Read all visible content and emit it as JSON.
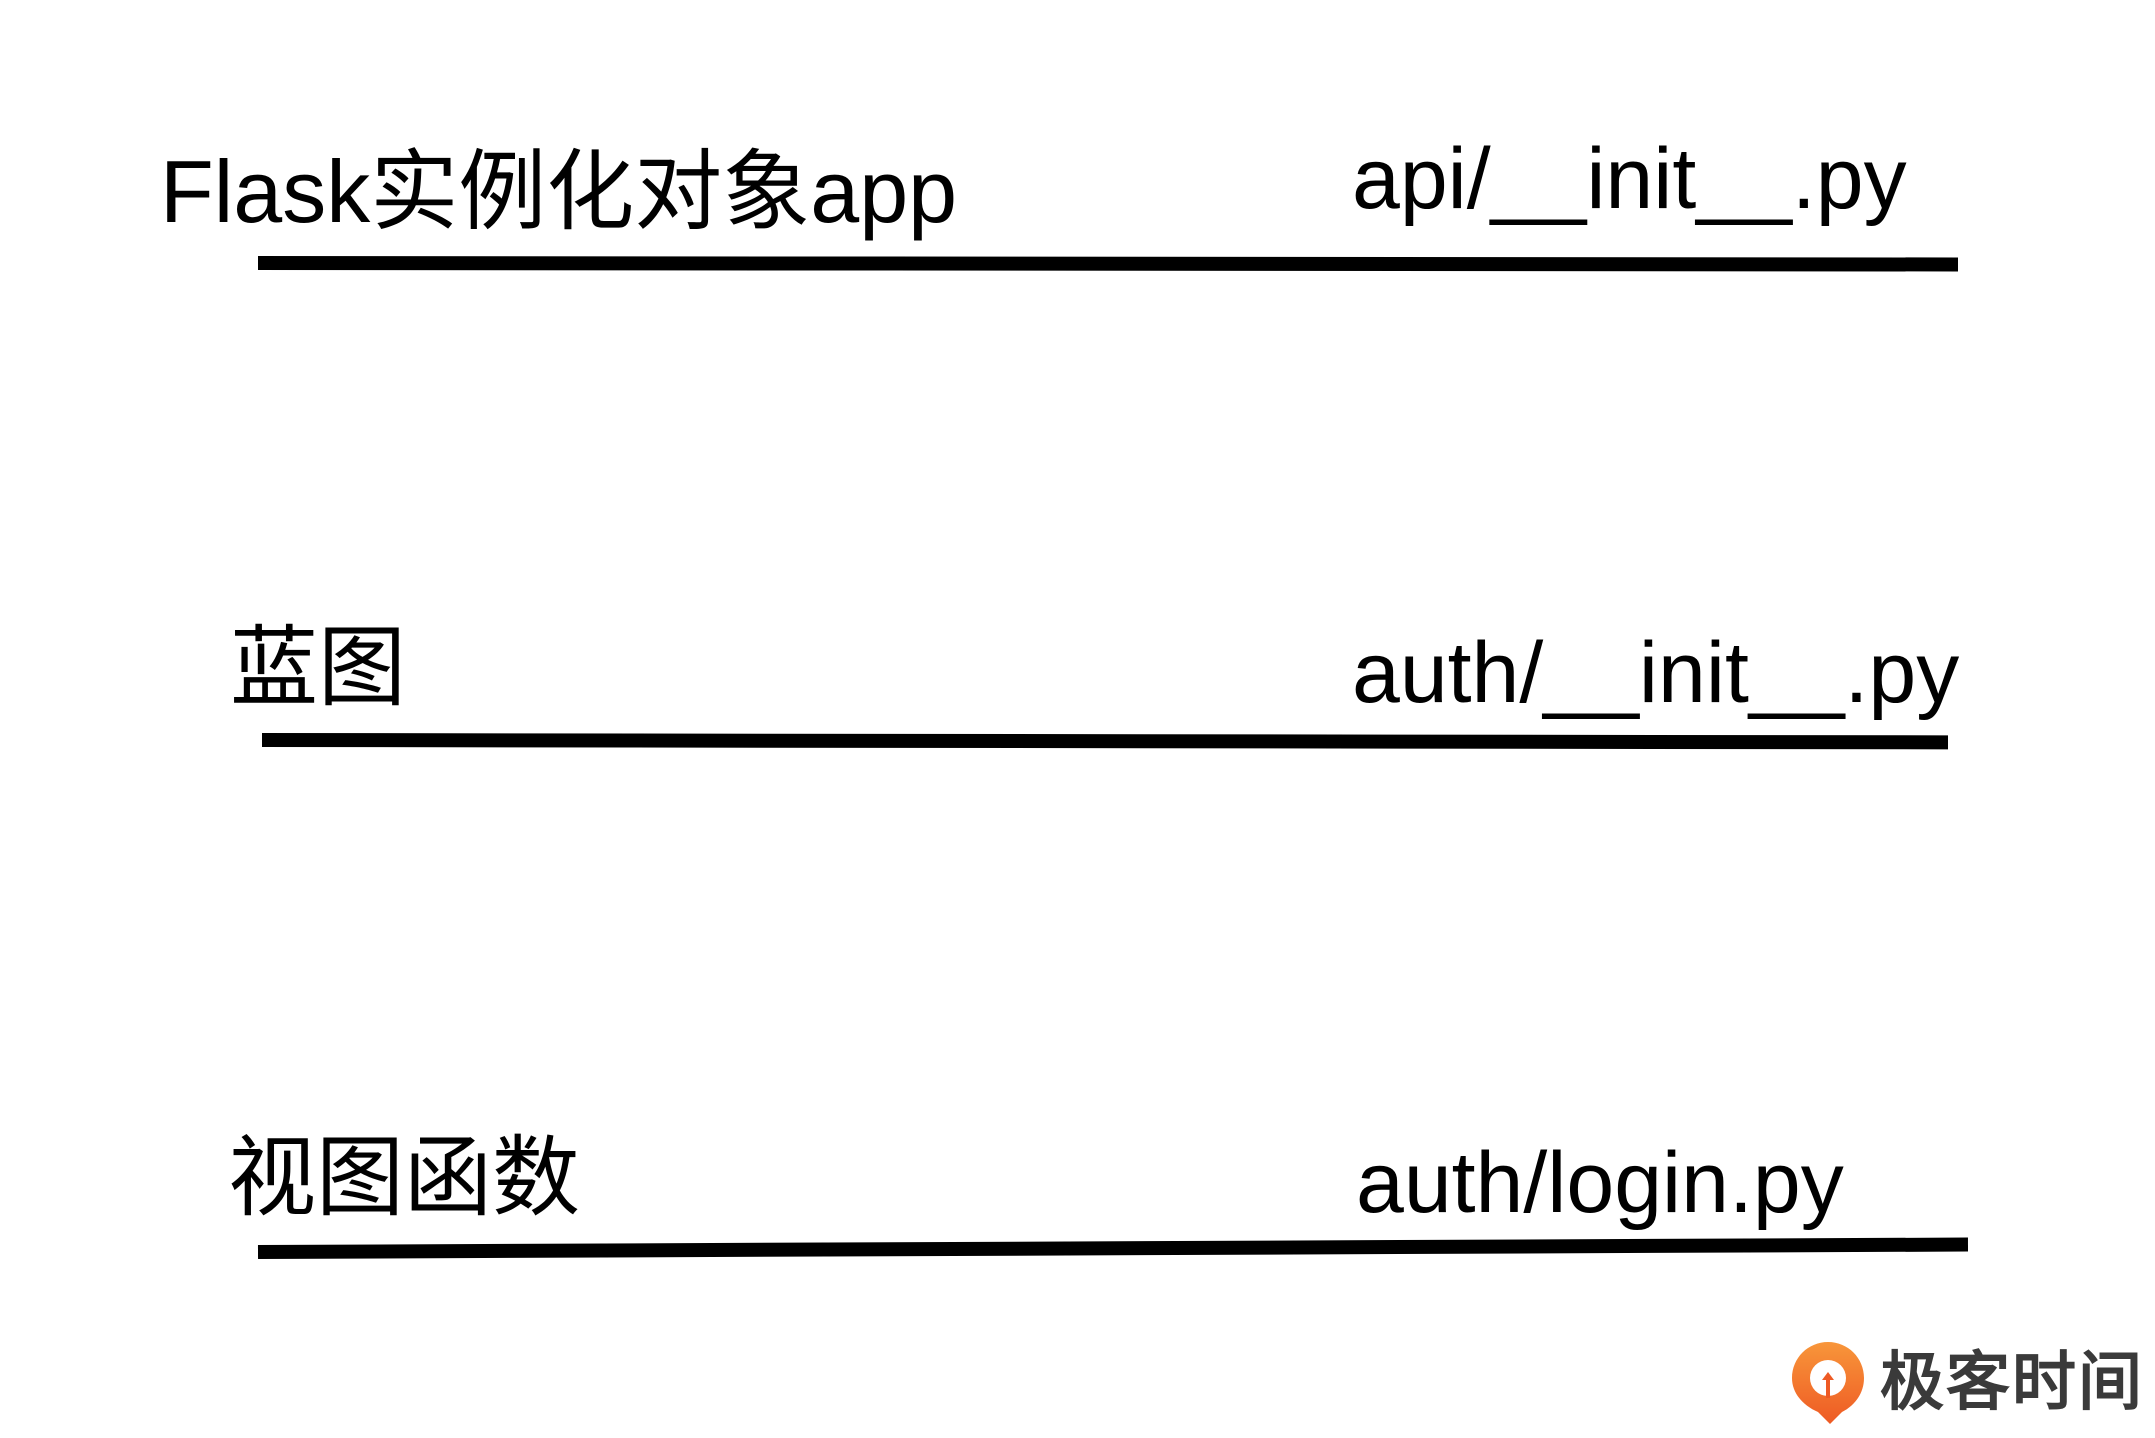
{
  "rows": [
    {
      "label": "Flask实例化对象app",
      "file": "api/__init__.py"
    },
    {
      "label": "蓝图",
      "file": "auth/__init__.py"
    },
    {
      "label": "视图函数",
      "file": "auth/login.py"
    }
  ],
  "brand": {
    "name": "极客时间",
    "icon": "geektime-logo-icon",
    "accent_color": "#F5742A"
  },
  "colors": {
    "text": "#000000",
    "rule": "#000000",
    "background": "#FFFFFF"
  }
}
